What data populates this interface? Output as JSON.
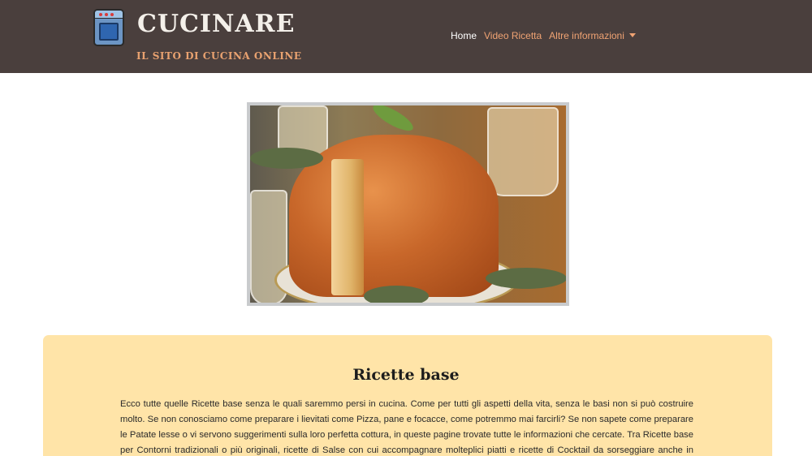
{
  "brand": {
    "title": "CUCINARE",
    "subtitle": "IL SITO DI CUCINA ONLINE",
    "logo_icon": "oven-icon"
  },
  "nav": {
    "home": "Home",
    "video": "Video Ricetta",
    "info": "Altre informazioni"
  },
  "hero": {
    "image": "ring-cake-photo"
  },
  "section": {
    "title": "Ricette base",
    "text": "Ecco tutte quelle Ricette base senza le quali saremmo persi in cucina. Come per tutti gli aspetti della vita, senza le basi non si può costruire molto. Se non conosciamo come preparare i lievitati come Pizza, pane e focacce, come potremmo mai farcirli? Se non sapete come preparare le Patate lesse o vi servono suggerimenti sulla loro perfetta cottura, in queste pagine trovate tutte le informazioni che cercate. Tra Ricette base per Contorni tradizionali o più originali, ricette di Salse con cui accompagnare molteplici piatti e ricette di Cocktail da sorseggiare anche in casa, in questa sezione ce ne sono per"
  },
  "colors": {
    "header_bg": "#4a3f3d",
    "accent": "#f0a373",
    "card_bg": "#ffe4a8"
  }
}
